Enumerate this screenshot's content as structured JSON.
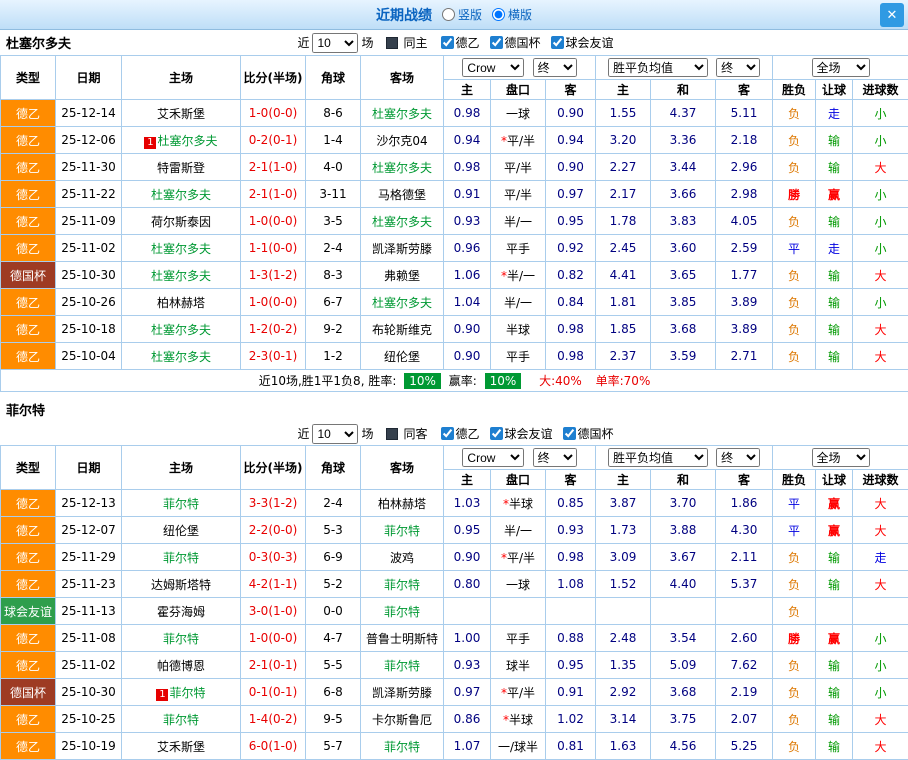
{
  "dialog": {
    "title": "近期战绩",
    "vertical_label": "竖版",
    "horizontal_label": "横版",
    "close_label": "✕"
  },
  "table_headers": {
    "type": "类型",
    "date": "日期",
    "home": "主场",
    "score": "比分(半场)",
    "corners": "角球",
    "away": "客场",
    "bookmaker": "Crow",
    "final1": "终",
    "avg": "胜平负均值",
    "final2": "终",
    "scope": "全场",
    "sub_home": "主",
    "sub_handicap": "盘口",
    "sub_away": "客",
    "sub_avg_home": "主",
    "sub_avg_draw": "和",
    "sub_avg_away": "客",
    "sub_result": "胜负",
    "sub_handicap_result": "让球",
    "sub_goals": "进球数"
  },
  "teams": [
    {
      "name": "杜塞尔多夫",
      "filter": {
        "near": "近",
        "count": "10",
        "games": "场",
        "same": "同主",
        "leagues": [
          "德乙",
          "德国杯",
          "球会友谊"
        ]
      },
      "rows": [
        {
          "type": "德乙",
          "date": "25-12-14",
          "home": "艾禾斯堡",
          "score": "1-0(0-0)",
          "corners": "8-6",
          "away": "杜塞尔多夫",
          "odds_home": "0.98",
          "handicap": "一球",
          "odds_away": "0.90",
          "avg_home": "1.55",
          "avg_draw": "4.37",
          "avg_away": "5.11",
          "result": "负",
          "handicap_result": "走",
          "goals": "小"
        },
        {
          "type": "德乙",
          "date": "25-12-06",
          "home": "杜塞尔多夫",
          "home_badge": "1",
          "score": "0-2(0-1)",
          "corners": "1-4",
          "away": "沙尔克04",
          "odds_home": "0.94",
          "handicap": "*平/半",
          "odds_away": "0.94",
          "avg_home": "3.20",
          "avg_draw": "3.36",
          "avg_away": "2.18",
          "result": "负",
          "handicap_result": "输",
          "goals": "小"
        },
        {
          "type": "德乙",
          "date": "25-11-30",
          "home": "特雷斯登",
          "score": "2-1(1-0)",
          "corners": "4-0",
          "away": "杜塞尔多夫",
          "odds_home": "0.98",
          "handicap": "平/半",
          "odds_away": "0.90",
          "avg_home": "2.27",
          "avg_draw": "3.44",
          "avg_away": "2.96",
          "result": "负",
          "handicap_result": "输",
          "goals": "大"
        },
        {
          "type": "德乙",
          "date": "25-11-22",
          "home": "杜塞尔多夫",
          "score": "2-1(1-0)",
          "corners": "3-11",
          "away": "马格德堡",
          "odds_home": "0.91",
          "handicap": "平/半",
          "odds_away": "0.97",
          "avg_home": "2.17",
          "avg_draw": "3.66",
          "avg_away": "2.98",
          "result": "勝",
          "handicap_result": "赢",
          "goals": "小"
        },
        {
          "type": "德乙",
          "date": "25-11-09",
          "home": "荷尔斯泰因",
          "score": "1-0(0-0)",
          "corners": "3-5",
          "away": "杜塞尔多夫",
          "odds_home": "0.93",
          "handicap": "半/一",
          "odds_away": "0.95",
          "avg_home": "1.78",
          "avg_draw": "3.83",
          "avg_away": "4.05",
          "result": "负",
          "handicap_result": "输",
          "goals": "小"
        },
        {
          "type": "德乙",
          "date": "25-11-02",
          "home": "杜塞尔多夫",
          "score": "1-1(0-0)",
          "corners": "2-4",
          "away": "凯泽斯劳滕",
          "odds_home": "0.96",
          "handicap": "平手",
          "odds_away": "0.92",
          "avg_home": "2.45",
          "avg_draw": "3.60",
          "avg_away": "2.59",
          "result": "平",
          "handicap_result": "走",
          "goals": "小"
        },
        {
          "type": "德国杯",
          "date": "25-10-30",
          "home": "杜塞尔多夫",
          "score": "1-3(1-2)",
          "corners": "8-3",
          "away": "弗赖堡",
          "odds_home": "1.06",
          "handicap": "*半/一",
          "odds_away": "0.82",
          "avg_home": "4.41",
          "avg_draw": "3.65",
          "avg_away": "1.77",
          "result": "负",
          "handicap_result": "输",
          "goals": "大"
        },
        {
          "type": "德乙",
          "date": "25-10-26",
          "home": "柏林赫塔",
          "score": "1-0(0-0)",
          "corners": "6-7",
          "away": "杜塞尔多夫",
          "odds_home": "1.04",
          "handicap": "半/一",
          "odds_away": "0.84",
          "avg_home": "1.81",
          "avg_draw": "3.85",
          "avg_away": "3.89",
          "result": "负",
          "handicap_result": "输",
          "goals": "小"
        },
        {
          "type": "德乙",
          "date": "25-10-18",
          "home": "杜塞尔多夫",
          "score": "1-2(0-2)",
          "corners": "9-2",
          "away": "布轮斯维克",
          "odds_home": "0.90",
          "handicap": "半球",
          "odds_away": "0.98",
          "avg_home": "1.85",
          "avg_draw": "3.68",
          "avg_away": "3.89",
          "result": "负",
          "handicap_result": "输",
          "goals": "大"
        },
        {
          "type": "德乙",
          "date": "25-10-04",
          "home": "杜塞尔多夫",
          "score": "2-3(0-1)",
          "corners": "1-2",
          "away": "纽伦堡",
          "odds_home": "0.90",
          "handicap": "平手",
          "odds_away": "0.98",
          "avg_home": "2.37",
          "avg_draw": "3.59",
          "avg_away": "2.71",
          "result": "负",
          "handicap_result": "输",
          "goals": "大"
        }
      ],
      "summary": {
        "lead": "近10场,胜1平1负8, 胜率:",
        "win_rate": "10%",
        "mid": "赢率:",
        "asian_rate": "10%",
        "tail_big": "大:40%",
        "tail_single": "单率:70%"
      }
    },
    {
      "name": "菲尔特",
      "filter": {
        "near": "近",
        "count": "10",
        "games": "场",
        "same": "同客",
        "leagues": [
          "德乙",
          "球会友谊",
          "德国杯"
        ]
      },
      "rows": [
        {
          "type": "德乙",
          "date": "25-12-13",
          "home": "菲尔特",
          "score": "3-3(1-2)",
          "corners": "2-4",
          "away": "柏林赫塔",
          "odds_home": "1.03",
          "handicap": "*半球",
          "odds_away": "0.85",
          "avg_home": "3.87",
          "avg_draw": "3.70",
          "avg_away": "1.86",
          "result": "平",
          "handicap_result": "赢",
          "goals": "大"
        },
        {
          "type": "德乙",
          "date": "25-12-07",
          "home": "纽伦堡",
          "score": "2-2(0-0)",
          "corners": "5-3",
          "away": "菲尔特",
          "odds_home": "0.95",
          "handicap": "半/一",
          "odds_away": "0.93",
          "avg_home": "1.73",
          "avg_draw": "3.88",
          "avg_away": "4.30",
          "result": "平",
          "handicap_result": "赢",
          "goals": "大"
        },
        {
          "type": "德乙",
          "date": "25-11-29",
          "home": "菲尔特",
          "score": "0-3(0-3)",
          "corners": "6-9",
          "away": "波鸡",
          "odds_home": "0.90",
          "handicap": "*平/半",
          "odds_away": "0.98",
          "avg_home": "3.09",
          "avg_draw": "3.67",
          "avg_away": "2.11",
          "result": "负",
          "handicap_result": "输",
          "goals": "走"
        },
        {
          "type": "德乙",
          "date": "25-11-23",
          "home": "达姆斯塔特",
          "score": "4-2(1-1)",
          "corners": "5-2",
          "away": "菲尔特",
          "odds_home": "0.80",
          "handicap": "一球",
          "odds_away": "1.08",
          "avg_home": "1.52",
          "avg_draw": "4.40",
          "avg_away": "5.37",
          "result": "负",
          "handicap_result": "输",
          "goals": "大"
        },
        {
          "type": "球会友谊",
          "date": "25-11-13",
          "home": "霍芬海姆",
          "score": "3-0(1-0)",
          "corners": "0-0",
          "away": "菲尔特",
          "odds_home": "",
          "handicap": "",
          "odds_away": "",
          "avg_home": "",
          "avg_draw": "",
          "avg_away": "",
          "result": "负",
          "handicap_result": "",
          "goals": ""
        },
        {
          "type": "德乙",
          "date": "25-11-08",
          "home": "菲尔特",
          "score": "1-0(0-0)",
          "corners": "4-7",
          "away": "普鲁士明斯特",
          "odds_home": "1.00",
          "handicap": "平手",
          "odds_away": "0.88",
          "avg_home": "2.48",
          "avg_draw": "3.54",
          "avg_away": "2.60",
          "result": "勝",
          "handicap_result": "赢",
          "goals": "小"
        },
        {
          "type": "德乙",
          "date": "25-11-02",
          "home": "帕德博恩",
          "score": "2-1(0-1)",
          "corners": "5-5",
          "away": "菲尔特",
          "odds_home": "0.93",
          "handicap": "球半",
          "odds_away": "0.95",
          "avg_home": "1.35",
          "avg_draw": "5.09",
          "avg_away": "7.62",
          "result": "负",
          "handicap_result": "输",
          "goals": "小"
        },
        {
          "type": "德国杯",
          "date": "25-10-30",
          "home": "菲尔特",
          "home_badge": "1",
          "score": "0-1(0-1)",
          "corners": "6-8",
          "away": "凯泽斯劳滕",
          "odds_home": "0.97",
          "handicap": "*平/半",
          "odds_away": "0.91",
          "avg_home": "2.92",
          "avg_draw": "3.68",
          "avg_away": "2.19",
          "result": "负",
          "handicap_result": "输",
          "goals": "小"
        },
        {
          "type": "德乙",
          "date": "25-10-25",
          "home": "菲尔特",
          "score": "1-4(0-2)",
          "corners": "9-5",
          "away": "卡尔斯鲁厄",
          "odds_home": "0.86",
          "handicap": "*半球",
          "odds_away": "1.02",
          "avg_home": "3.14",
          "avg_draw": "3.75",
          "avg_away": "2.07",
          "result": "负",
          "handicap_result": "输",
          "goals": "大"
        },
        {
          "type": "德乙",
          "date": "25-10-19",
          "home": "艾禾斯堡",
          "score": "6-0(1-0)",
          "corners": "5-7",
          "away": "菲尔特",
          "odds_home": "1.07",
          "handicap": "一/球半",
          "odds_away": "0.81",
          "avg_home": "1.63",
          "avg_draw": "4.56",
          "avg_away": "5.25",
          "result": "负",
          "handicap_result": "输",
          "goals": "大"
        }
      ]
    }
  ]
}
